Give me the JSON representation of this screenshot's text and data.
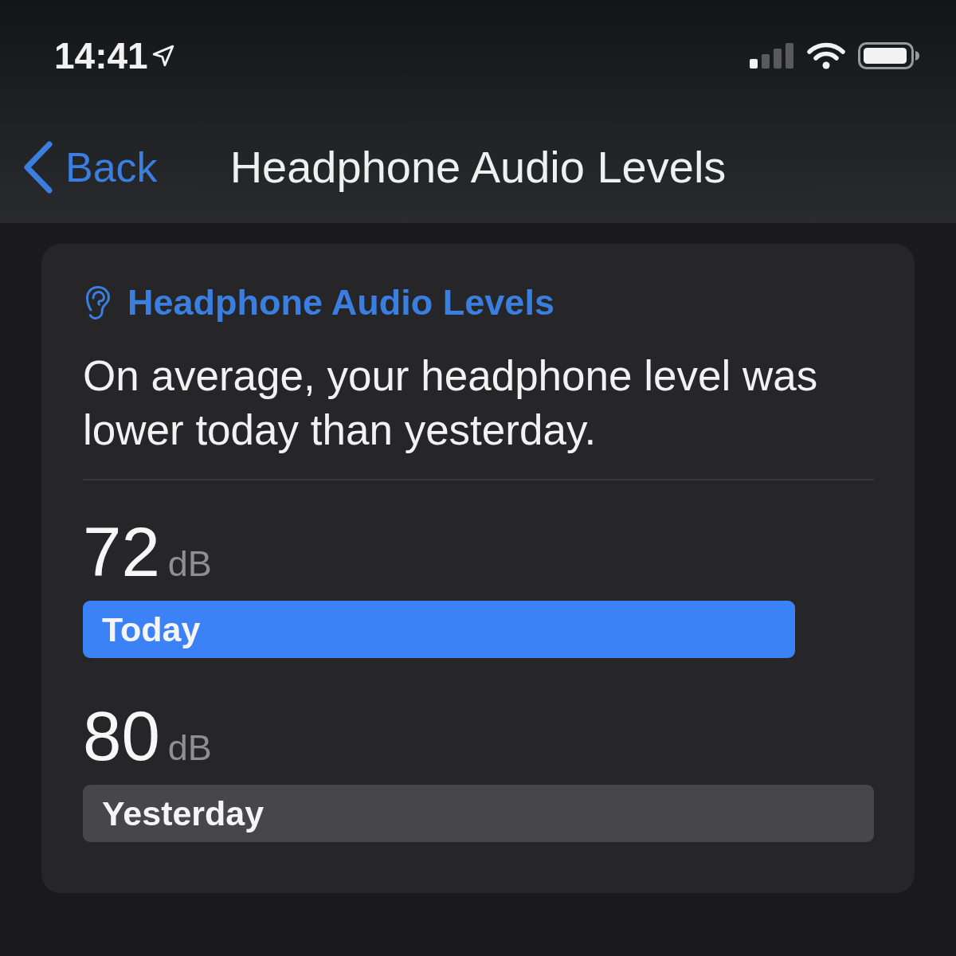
{
  "status_bar": {
    "time": "14:41"
  },
  "nav_bar": {
    "back_label": "Back",
    "title": "Headphone Audio Levels"
  },
  "card": {
    "header": "Headphone Audio Levels",
    "summary": "On average, your headphone level was lower today than yesterday.",
    "bars": [
      {
        "value": "72",
        "unit": "dB",
        "label": "Today",
        "color": "#3a82f6"
      },
      {
        "value": "80",
        "unit": "dB",
        "label": "Yesterday",
        "color": "#47474b"
      }
    ]
  }
}
